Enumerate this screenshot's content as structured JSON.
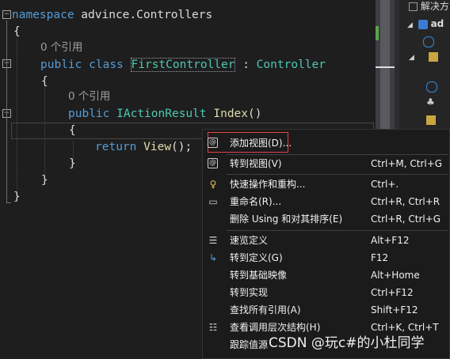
{
  "editor": {
    "lines": {
      "l1_kw": "namespace",
      "l1_rest": " advince.Controllers",
      "l2": "{",
      "l3_refs": "0 个引用",
      "l4_public": "public",
      "l4_class": "class",
      "l4_name": "FirstController",
      "l4_colon": " : ",
      "l4_base": "Controller",
      "l5": "{",
      "l6_refs": "0 个引用",
      "l7_public": "public",
      "l7_type": "IActionResult",
      "l7_method": "Index",
      "l7_parens": "()",
      "l8": "{",
      "l9_return": "return",
      "l9_view": "View",
      "l9_rest": "();",
      "l10": "}",
      "l11": "}",
      "l12": "}"
    }
  },
  "solution_explorer": {
    "title_fragment": "解决方",
    "project_fragment": "ad"
  },
  "context_menu": {
    "items": [
      {
        "label": "添加视图(D)...",
        "shortcut": "",
        "icon": "add-view-icon"
      },
      {
        "label": "转到视图(V)",
        "shortcut": "Ctrl+M, Ctrl+G",
        "icon": "goto-view-icon"
      },
      {
        "label": "快速操作和重构...",
        "shortcut": "Ctrl+.",
        "icon": "lightbulb-icon"
      },
      {
        "label": "重命名(R)...",
        "shortcut": "Ctrl+R, Ctrl+R",
        "icon": "rename-icon"
      },
      {
        "label": "删除 Using 和对其排序(E)",
        "shortcut": "Ctrl+R, Ctrl+G",
        "icon": ""
      },
      {
        "label": "速览定义",
        "shortcut": "Alt+F12",
        "icon": "peek-definition-icon"
      },
      {
        "label": "转到定义(G)",
        "shortcut": "F12",
        "icon": "goto-definition-icon"
      },
      {
        "label": "转到基础映像",
        "shortcut": "Alt+Home",
        "icon": ""
      },
      {
        "label": "转到实现",
        "shortcut": "Ctrl+F12",
        "icon": ""
      },
      {
        "label": "查找所有引用(A)",
        "shortcut": "Shift+F12",
        "icon": ""
      },
      {
        "label": "查看调用层次结构(H)",
        "shortcut": "Ctrl+K, Ctrl+T",
        "icon": "call-hierarchy-icon"
      },
      {
        "label": "跟踪值源",
        "shortcut": "",
        "icon": ""
      }
    ]
  },
  "watermark": "CSDN @玩c#的小杜同学",
  "colors": {
    "keyword": "#569cd6",
    "type": "#4ec9b0",
    "method": "#dcdcaa",
    "highlight_border": "#e04343"
  }
}
